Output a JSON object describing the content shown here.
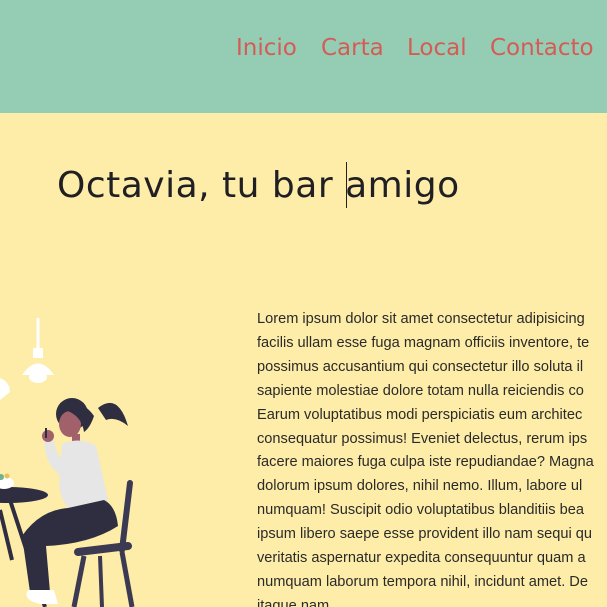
{
  "nav": {
    "items": [
      "Inicio",
      "Carta",
      "Local",
      "Contacto"
    ]
  },
  "hero": {
    "title": "Octavia, tu bar amigo"
  },
  "content": {
    "lines": [
      "Lorem ipsum dolor sit amet consectetur adipisicing",
      "facilis ullam esse fuga magnam officiis inventore, te",
      "possimus accusantium qui consectetur illo soluta il",
      "sapiente molestiae dolore totam nulla reiciendis co",
      "Earum voluptatibus modi perspiciatis eum architec",
      "consequatur possimus! Eveniet delectus, rerum ips",
      "facere maiores fuga culpa iste repudiandae? Magna",
      "dolorum ipsum dolores, nihil nemo. Illum, labore ul",
      "numquam! Suscipit odio voluptatibus blanditiis bea",
      "ipsum libero saepe esse provident illo nam sequi qu",
      "veritatis aspernatur expedita consequuntur quam a",
      "numquam laborum tempora nihil, incidunt amet. De",
      "itaque nam"
    ]
  },
  "colors": {
    "header_bg": "#95cdb4",
    "page_bg": "#fdeda8",
    "nav_link": "#d55b55",
    "title_text": "#1f1f24"
  },
  "icons": {
    "illustration": "woman-at-cafe-table-illustration"
  }
}
